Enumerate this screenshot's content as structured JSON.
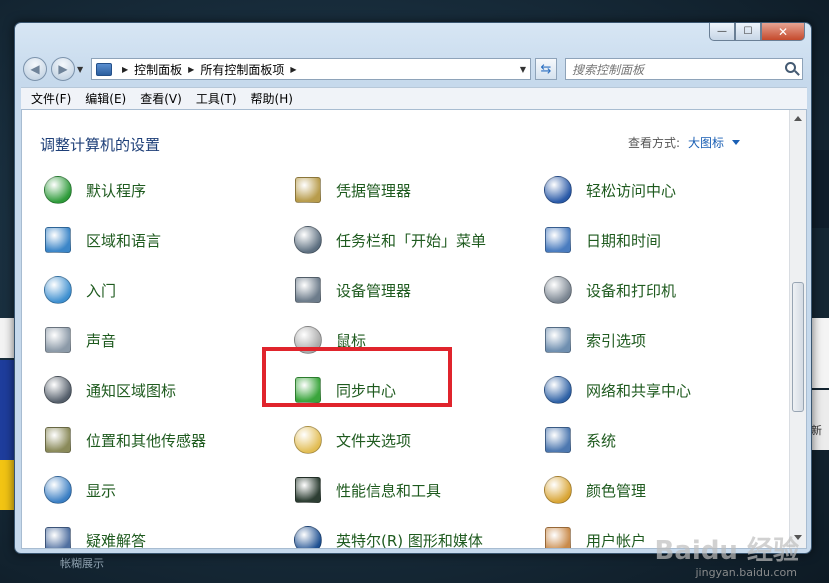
{
  "window": {
    "controls": {
      "minimize": "—",
      "maximize": "☐",
      "close": "✕"
    }
  },
  "address": {
    "crumbs": [
      "控制面板",
      "所有控制面板项"
    ],
    "search_placeholder": "搜索控制面板"
  },
  "menu": [
    "文件(F)",
    "编辑(E)",
    "查看(V)",
    "工具(T)",
    "帮助(H)"
  ],
  "content": {
    "title": "调整计算机的设置",
    "view_by_label": "查看方式:",
    "view_by_value": "大图标"
  },
  "items": [
    {
      "label": "默认程序",
      "icon": "default-programs-icon",
      "color": "#2e9b3a"
    },
    {
      "label": "凭据管理器",
      "icon": "credential-manager-icon",
      "color": "#b89c4c"
    },
    {
      "label": "轻松访问中心",
      "icon": "ease-of-access-icon",
      "color": "#2a5aa8"
    },
    {
      "label": "区域和语言",
      "icon": "region-language-icon",
      "color": "#3c86c8"
    },
    {
      "label": "任务栏和「开始」菜单",
      "icon": "taskbar-start-icon",
      "color": "#5d6f80"
    },
    {
      "label": "日期和时间",
      "icon": "date-time-icon",
      "color": "#4a7cbf"
    },
    {
      "label": "入门",
      "icon": "getting-started-icon",
      "color": "#3f90d0"
    },
    {
      "label": "设备管理器",
      "icon": "device-manager-icon",
      "color": "#6d7c8b"
    },
    {
      "label": "设备和打印机",
      "icon": "devices-printers-icon",
      "color": "#7a8591"
    },
    {
      "label": "声音",
      "icon": "sound-icon",
      "color": "#8c9aa8"
    },
    {
      "label": "鼠标",
      "icon": "mouse-icon",
      "color": "#a9a9a9"
    },
    {
      "label": "索引选项",
      "icon": "indexing-options-icon",
      "color": "#6f8fb0"
    },
    {
      "label": "通知区域图标",
      "icon": "notification-area-icon",
      "color": "#555f6b"
    },
    {
      "label": "同步中心",
      "icon": "sync-center-icon",
      "color": "#3aa53c"
    },
    {
      "label": "网络和共享中心",
      "icon": "network-sharing-icon",
      "color": "#2f62a6"
    },
    {
      "label": "位置和其他传感器",
      "icon": "location-sensors-icon",
      "color": "#8a8a5a"
    },
    {
      "label": "文件夹选项",
      "icon": "folder-options-icon",
      "color": "#e2bd54"
    },
    {
      "label": "系统",
      "icon": "system-icon",
      "color": "#4d78b0"
    },
    {
      "label": "显示",
      "icon": "display-icon",
      "color": "#3b7fc4"
    },
    {
      "label": "性能信息和工具",
      "icon": "performance-tools-icon",
      "color": "#2d3e33"
    },
    {
      "label": "颜色管理",
      "icon": "color-management-icon",
      "color": "#d9a535"
    },
    {
      "label": "疑难解答",
      "icon": "troubleshooting-icon",
      "color": "#4f6fa0"
    },
    {
      "label": "英特尔(R) 图形和媒体",
      "icon": "intel-graphics-icon",
      "color": "#1d4f91"
    },
    {
      "label": "用户帐户",
      "icon": "user-accounts-icon",
      "color": "#c98a4a"
    }
  ],
  "desktop": {
    "right_text": "新",
    "bottom_text": "帐糊展示"
  },
  "watermark": {
    "brand": "Baidu 经验",
    "url": "jingyan.baidu.com"
  }
}
